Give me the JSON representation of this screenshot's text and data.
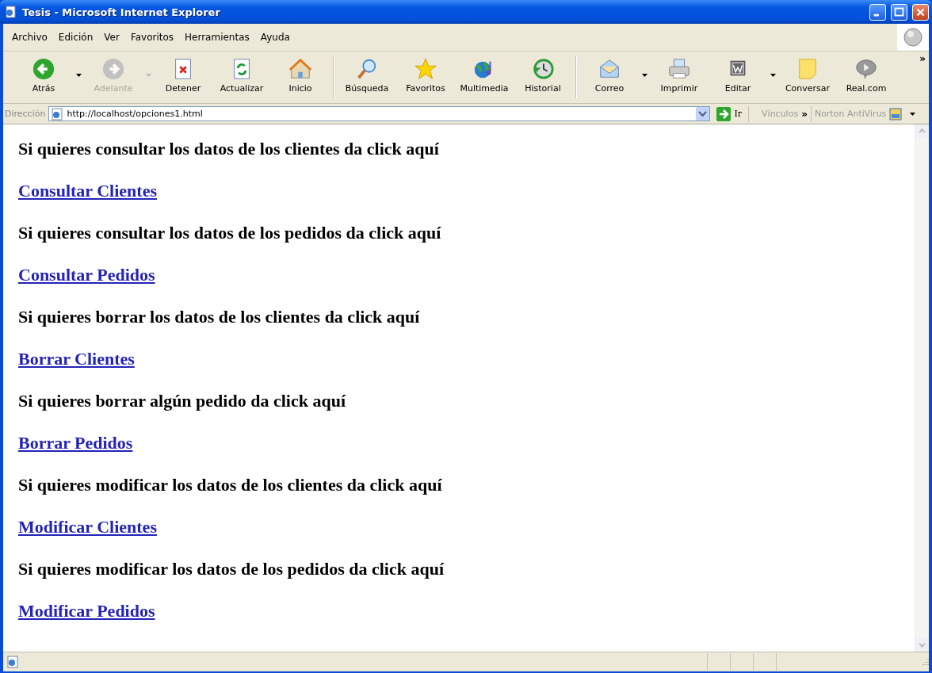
{
  "window": {
    "title": "Tesis - Microsoft Internet Explorer"
  },
  "menu": [
    "Archivo",
    "Edición",
    "Ver",
    "Favoritos",
    "Herramientas",
    "Ayuda"
  ],
  "toolbar": [
    {
      "label": "Atrás",
      "disabled": false,
      "dropdown": true
    },
    {
      "label": "Adelante",
      "disabled": true,
      "dropdown": true
    },
    {
      "label": "Detener",
      "disabled": false,
      "dropdown": false
    },
    {
      "label": "Actualizar",
      "disabled": false,
      "dropdown": false
    },
    {
      "label": "Inicio",
      "disabled": false,
      "dropdown": false,
      "separator_after": true
    },
    {
      "label": "Búsqueda",
      "disabled": false,
      "dropdown": false
    },
    {
      "label": "Favoritos",
      "disabled": false,
      "dropdown": false
    },
    {
      "label": "Multimedia",
      "disabled": false,
      "dropdown": false
    },
    {
      "label": "Historial",
      "disabled": false,
      "dropdown": false,
      "separator_after": true
    },
    {
      "label": "Correo",
      "disabled": false,
      "dropdown": true
    },
    {
      "label": "Imprimir",
      "disabled": false,
      "dropdown": false
    },
    {
      "label": "Editar",
      "disabled": false,
      "dropdown": true
    },
    {
      "label": "Conversar",
      "disabled": false,
      "dropdown": false
    },
    {
      "label": "Real.com",
      "disabled": false,
      "dropdown": false
    }
  ],
  "address_bar": {
    "label": "Dirección",
    "url": "http://localhost/opciones1.html",
    "go": "Ir",
    "links": "Vínculos",
    "links_more": "»",
    "norton": "Norton AntiVirus"
  },
  "content": [
    {
      "kind": "text",
      "text": "Si quieres consultar los datos de los clientes da click aquí"
    },
    {
      "kind": "link",
      "text": "Consultar Clientes"
    },
    {
      "kind": "text",
      "text": "Si quieres consultar los datos de los pedidos da click aquí"
    },
    {
      "kind": "link",
      "text": "Consultar Pedidos"
    },
    {
      "kind": "text",
      "text": "Si quieres borrar los datos de los clientes da click aquí"
    },
    {
      "kind": "link",
      "text": "Borrar Clientes"
    },
    {
      "kind": "text",
      "text": "Si quieres borrar algún pedido da click aquí"
    },
    {
      "kind": "link",
      "text": "Borrar Pedidos"
    },
    {
      "kind": "text",
      "text": "Si quieres modificar los datos de los clientes da click aquí"
    },
    {
      "kind": "link",
      "text": "Modificar Clientes"
    },
    {
      "kind": "text",
      "text": "Si quieres modificar los datos de los pedidos da click aquí"
    },
    {
      "kind": "link",
      "text": "Modificar Pedidos"
    }
  ]
}
